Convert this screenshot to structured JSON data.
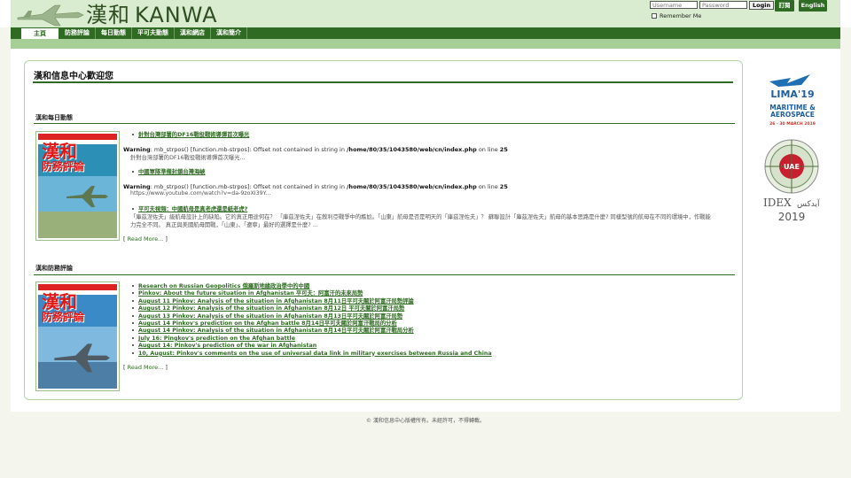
{
  "header": {
    "logo_cjk": "漢和",
    "logo_latin": "KANWA",
    "username_placeholder": "Username",
    "password_placeholder": "Password",
    "login_label": "Login",
    "remember_label": "Remember Me",
    "subscribe_label": "訂閱",
    "english_label": "English"
  },
  "nav": {
    "items": [
      {
        "label": "主頁"
      },
      {
        "label": "防務評論"
      },
      {
        "label": "每日動態"
      },
      {
        "label": "平可夫動態"
      },
      {
        "label": "漢和網店"
      },
      {
        "label": "漢和簡介"
      }
    ]
  },
  "main": {
    "welcome_title": "漢和信息中心歡迎您",
    "daily": {
      "title": "漢和每日動態",
      "cover": {
        "big": "漢和",
        "sub": "防務評論"
      },
      "items": [
        {
          "link": "針對台灣部署的DF16戰役戰術導彈首次曝光",
          "warning_label": "Warning",
          "warning_text": ": mb_strpos() [function.mb-strpos]: Offset not contained in string in ",
          "warning_path": "/home/80/35/1043580/web/cn/index.php",
          "warning_line_label": " on line ",
          "warning_line": "25",
          "snippet": "針對台灣部署的DF16戰役戰術導彈首次曝光..."
        },
        {
          "link": "中國軍隊準備封鎖台灣海峽",
          "warning_label": "Warning",
          "warning_text": ": mb_strpos() [function.mb-strpos]: Offset not contained in string in ",
          "warning_path": "/home/80/35/1043580/web/cn/index.php",
          "warning_line_label": " on line ",
          "warning_line": "25",
          "snippet": "https://www.youtube.com/watch?v=da-9zoXI39Y..."
        },
        {
          "link": "平可夫視頻：中國航母是真老虎還是紙老虎?",
          "snippet_1": "「庫茲涅佐夫」級航母設計上的缺陷。它的真正用途何在？ 「庫茲涅佐夫」在敘利亞戰爭中的尷尬。「山東」航母是否是明天的「庫茲涅佐夫」？ 蘇聯設計「庫茲涅佐夫」航母的基本思路是什麼? 同樣型號的航母在不同的環境中，作戰能",
          "snippet_2": "力完全不同。 真正與美國航母開戰，「山東」、「遼寧」最好的選擇是什麼? ..."
        }
      ],
      "read_more": "Read More..."
    },
    "defense": {
      "title": "漢和防務評論",
      "cover": {
        "big": "漢和",
        "sub": "防務評論"
      },
      "links": [
        "Research on Russian Geopolitics 俄羅斯地緣政治學中的中國",
        "Pinkov: About the future situation in Afghanistan 平可夫：阿富汗的未來局勢",
        "August 11 Pinkov: Analysis of the situation in Afghanistan 8月11日平可夫關於阿富汗局勢評論",
        "August 12 Pinkov: Analysis of the situation in Afghanistan 8月12日 平可夫關於阿富汗局勢",
        "August 13 Pinkov: Analysis of the situation in Afghanistan 8月13日平可夫關於阿富汗局勢",
        "August 14 Pinkov's prediction on the Afghan battle 8月14日平可夫關於阿富汗戰局的分析",
        "August 14 Pinkov: Analysis of the situation in Afghanistan 8月14日平可夫關於阿富汗戰局分析",
        "July 16: Pingkov's prediction on the Afghan battle",
        "August 14: Pinkov's prediction of the war in Afghanistan",
        "10, August: Pinkov's comments on the use of universal data link in military exercises between Russia and China"
      ],
      "read_more": "Read More..."
    }
  },
  "ads": {
    "lima": {
      "title": "LIMA'19",
      "line1": "MARITIME &",
      "line2": "AEROSPACE",
      "dates": "26 - 30 MARCH 2019"
    },
    "idex": {
      "badge": "UAE",
      "brand": "IDEX",
      "arabic": "آيدكس",
      "year": "2019"
    }
  },
  "footer": {
    "text": "© 漢和信息中心版權所有。未經許可，不得轉載。"
  },
  "colors": {
    "brand_green": "#2f6b22",
    "light_green": "#a8ce98",
    "header_band": "#d9ecd0"
  }
}
